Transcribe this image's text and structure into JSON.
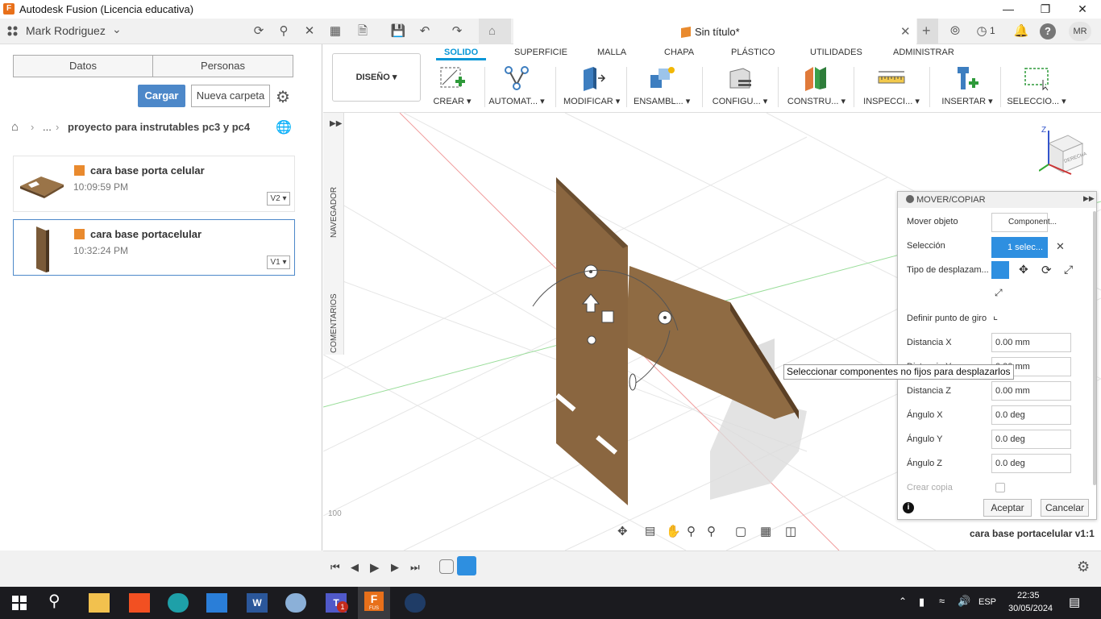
{
  "window": {
    "title": "Autodesk Fusion (Licencia educativa)",
    "app_icon": "F"
  },
  "appbar": {
    "user": "Mark Rodriguez",
    "doc_tab": "Sin título*",
    "notif_count": "1",
    "avatar": "MR"
  },
  "leftpanel": {
    "tabs": [
      "Datos",
      "Personas"
    ],
    "upload": "Cargar",
    "new_folder": "Nueva carpeta",
    "breadcrumb_ellipsis": "...",
    "breadcrumb_project": "proyecto para instrutables pc3 y pc4",
    "files": [
      {
        "name": "cara base porta celular",
        "time": "10:09:59 PM",
        "version": "V2"
      },
      {
        "name": "cara base portacelular",
        "time": "10:32:24 PM",
        "version": "V1"
      }
    ]
  },
  "toolbar": {
    "workspace": "DISEÑO",
    "tabs": [
      "SOLIDO",
      "SUPERFICIE",
      "MALLA",
      "CHAPA",
      "PLÁSTICO",
      "UTILIDADES",
      "ADMINISTRAR"
    ],
    "groups": [
      "CREAR",
      "AUTOMAT...",
      "MODIFICAR",
      "ENSAMBL...",
      "CONFIGU...",
      "CONSTRU...",
      "INSPECCI...",
      "INSERTAR",
      "SELECCIO..."
    ]
  },
  "side_labels": {
    "navigator": "NAVEGADOR",
    "comments": "COMENTARIOS"
  },
  "viewcube": {
    "axis": "Z",
    "face": "DERECHA"
  },
  "axis_label": "100",
  "dialog": {
    "title": "MOVER/COPIAR",
    "move_object_label": "Mover objeto",
    "move_object_value": "Component...",
    "selection_label": "Selección",
    "selection_value": "1 selec...",
    "move_type_label": "Tipo de desplazam...",
    "pivot_label": "Definir punto de giro",
    "fields": [
      {
        "label": "Distancia X",
        "value": "0.00 mm"
      },
      {
        "label": "Distancia Y",
        "value": "0.00 mm"
      },
      {
        "label": "Distancia Z",
        "value": "0.00 mm"
      },
      {
        "label": "Ángulo X",
        "value": "0.0 deg"
      },
      {
        "label": "Ángulo Y",
        "value": "0.0 deg"
      },
      {
        "label": "Ángulo Z",
        "value": "0.0 deg"
      }
    ],
    "create_copy": "Crear copia",
    "ok": "Aceptar",
    "cancel": "Cancelar"
  },
  "tooltip": "Seleccionar componentes no fijos para desplazarlos",
  "doc_name": "cara base portacelular v1:1",
  "taskbar": {
    "time": "22:35",
    "date": "30/05/2024",
    "lang": "ESP",
    "teams_badge": "1",
    "fusion_label": "FUS"
  },
  "colors": {
    "accent": "#0696d7",
    "upload": "#4d88c9",
    "wood": "#8a6a44"
  }
}
